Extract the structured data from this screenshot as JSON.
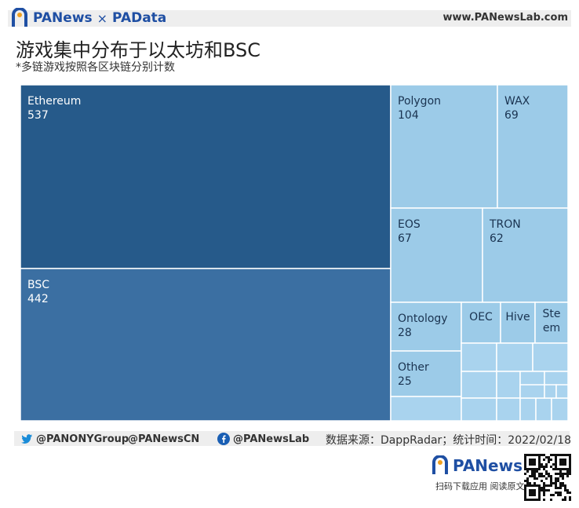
{
  "header": {
    "brand_left": "PANews",
    "brand_sep": "×",
    "brand_right": "PAData",
    "site": "www.PANewsLab.com"
  },
  "title": "游戏集中分布于以太坊和BSC",
  "subtitle": "*多链游戏按照各区块链分别计数",
  "chart_data": {
    "type": "treemap",
    "title": "游戏集中分布于以太坊和BSC",
    "subtitle": "*多链游戏按照各区块链分别计数",
    "items": [
      {
        "name": "Ethereum",
        "value": 537
      },
      {
        "name": "BSC",
        "value": 442
      },
      {
        "name": "Polygon",
        "value": 104
      },
      {
        "name": "WAX",
        "value": 69
      },
      {
        "name": "EOS",
        "value": 67
      },
      {
        "name": "TRON",
        "value": 62
      },
      {
        "name": "Ontology",
        "value": 28
      },
      {
        "name": "OEC",
        "value": null
      },
      {
        "name": "Hive",
        "value": null
      },
      {
        "name": "Steem",
        "value": null
      },
      {
        "name": "Other",
        "value": 25
      }
    ],
    "colors": {
      "dark": "#265a8a",
      "mid": "#3b6fa2",
      "light": "#9ccbe8",
      "lighter": "#a9d3ee"
    }
  },
  "footer": {
    "twitter": "@PANONYGroup",
    "weibo": "@PANewsCN",
    "facebook": "@PANewsLab",
    "source": "数据来源：DappRadar；统计时间：2022/02/18"
  },
  "bottom": {
    "logo": "PANews",
    "slogan": "扫码下载应用  阅读原文"
  },
  "icons": [
    "twitter-icon",
    "facebook-icon",
    "panews-logo-icon",
    "qr-code"
  ]
}
